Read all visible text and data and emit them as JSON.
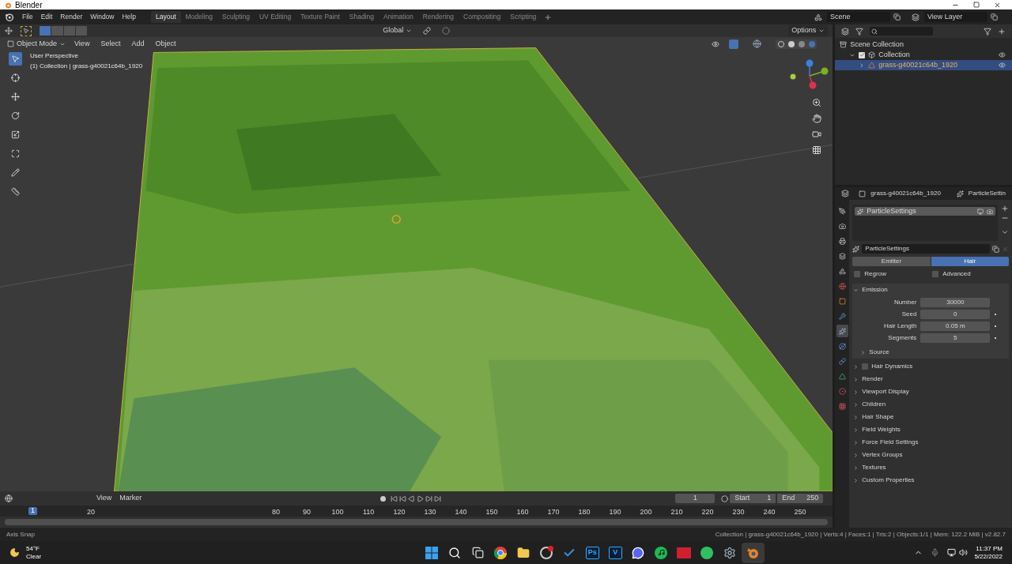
{
  "window": {
    "title": "Blender"
  },
  "menu": [
    "File",
    "Edit",
    "Render",
    "Window",
    "Help"
  ],
  "workspaces": [
    {
      "label": "Layout",
      "selected": true
    },
    {
      "label": "Modeling",
      "selected": false
    },
    {
      "label": "Sculpting",
      "selected": false
    },
    {
      "label": "UV Editing",
      "selected": false
    },
    {
      "label": "Texture Paint",
      "selected": false
    },
    {
      "label": "Shading",
      "selected": false
    },
    {
      "label": "Animation",
      "selected": false
    },
    {
      "label": "Rendering",
      "selected": false
    },
    {
      "label": "Compositing",
      "selected": false
    },
    {
      "label": "Scripting",
      "selected": false
    }
  ],
  "scene": "Scene",
  "view_layer": "View Layer",
  "viewport": {
    "orientation": "Global",
    "options": "Options",
    "mode": "Object Mode",
    "menus": [
      "View",
      "Select",
      "Add",
      "Object"
    ],
    "overlay_lines": [
      "User Perspective",
      "(1) Collection | grass-g40021c64b_1920"
    ],
    "tools": [
      {
        "kind": "select",
        "selected": true
      },
      {
        "kind": "cursor",
        "selected": false
      },
      {
        "kind": "move",
        "selected": false
      },
      {
        "kind": "rotate",
        "selected": false
      },
      {
        "kind": "scale",
        "selected": false
      },
      {
        "kind": "transform",
        "selected": false
      },
      {
        "kind": "annotate",
        "selected": false
      },
      {
        "kind": "measure",
        "selected": false
      }
    ]
  },
  "timeline": {
    "menus": [
      "View",
      "Marker"
    ],
    "current_frame": "1",
    "start_label": "Start",
    "start": "1",
    "end_label": "End",
    "end": "250",
    "playhead": "1",
    "ticks": [
      "20",
      "80",
      "90",
      "100",
      "110",
      "120",
      "130",
      "140",
      "150",
      "160",
      "170",
      "180",
      "190",
      "200",
      "210",
      "220",
      "230",
      "240",
      "250"
    ]
  },
  "outliner": {
    "items": [
      {
        "label": "Scene Collection",
        "kind": "scene",
        "selected": false,
        "children": [
          {
            "label": "Collection",
            "kind": "collection",
            "selected": false,
            "expanded": true,
            "checked": true,
            "children": [
              {
                "label": "grass-g40021c64b_1920",
                "kind": "object",
                "selected": true,
                "expanded": false
              }
            ]
          }
        ]
      }
    ]
  },
  "properties": {
    "object_name": "grass-g40021c64b_1920",
    "context": "ParticleSettin",
    "tabs": [
      {
        "kind": "tool",
        "selected": false
      },
      {
        "kind": "render",
        "selected": false
      },
      {
        "kind": "output",
        "selected": false
      },
      {
        "kind": "view_layer",
        "selected": false
      },
      {
        "kind": "scene",
        "selected": false
      },
      {
        "kind": "world",
        "selected": false
      },
      {
        "kind": "object",
        "selected": false
      },
      {
        "kind": "modifiers",
        "selected": false
      },
      {
        "kind": "particles",
        "selected": true
      },
      {
        "kind": "physics",
        "selected": false
      },
      {
        "kind": "constraints",
        "selected": false
      },
      {
        "kind": "data",
        "selected": false
      },
      {
        "kind": "material",
        "selected": false
      },
      {
        "kind": "texture",
        "selected": false
      }
    ],
    "particle_systems": [
      {
        "name": "ParticleSettings",
        "selected": true
      }
    ],
    "settings_name": "ParticleSettings",
    "type_options": [
      {
        "label": "Emitter",
        "selected": false
      },
      {
        "label": "Hair",
        "selected": true
      }
    ],
    "toggles": [
      {
        "label": "Regrow",
        "checked": false
      },
      {
        "label": "Advanced",
        "checked": false
      }
    ],
    "panels": [
      {
        "label": "Emission",
        "kind": "plain",
        "expanded": true,
        "fields": [
          {
            "label": "Number",
            "value": "30000",
            "keyframe_dot": false
          },
          {
            "label": "Seed",
            "value": "0",
            "keyframe_dot": true
          },
          {
            "label": "Hair Length",
            "value": "0.05 m",
            "keyframe_dot": true
          },
          {
            "label": "Segments",
            "value": "5",
            "keyframe_dot": true
          }
        ],
        "subpanels": [
          {
            "label": "Source",
            "expanded": false
          }
        ]
      },
      {
        "label": "Hair Dynamics",
        "kind": "toggle",
        "checked": false,
        "expanded": false
      },
      {
        "label": "Render",
        "kind": "plain",
        "expanded": false
      },
      {
        "label": "Viewport Display",
        "kind": "plain",
        "expanded": false
      },
      {
        "label": "Children",
        "kind": "plain",
        "expanded": false
      },
      {
        "label": "Hair Shape",
        "kind": "plain",
        "expanded": false
      },
      {
        "label": "Field Weights",
        "kind": "plain",
        "expanded": false
      },
      {
        "label": "Force Field Settings",
        "kind": "plain",
        "expanded": false
      },
      {
        "label": "Vertex Groups",
        "kind": "plain",
        "expanded": false
      },
      {
        "label": "Textures",
        "kind": "plain",
        "expanded": false
      },
      {
        "label": "Custom Properties",
        "kind": "plain",
        "expanded": false
      }
    ]
  },
  "status_bar": {
    "left": "Axis Snap",
    "right": "Collection | grass-g40021c64b_1920 | Verts:4 | Faces:1 | Tris:2 | Objects:1/1 | Mem: 122.2 MiB | v2.82.7"
  },
  "taskbar": {
    "weather": {
      "temp": "54°F",
      "condition": "Clear"
    },
    "apps": [
      {
        "kind": "start",
        "selected": false
      },
      {
        "kind": "search",
        "selected": false
      },
      {
        "kind": "taskview",
        "selected": false
      },
      {
        "kind": "browser",
        "selected": false
      },
      {
        "kind": "folder",
        "selected": false
      },
      {
        "kind": "recorder",
        "selected": false
      },
      {
        "kind": "check",
        "selected": false
      },
      {
        "kind": "lettered",
        "label": "Ps",
        "selected": false
      },
      {
        "kind": "lettered",
        "label": "V",
        "selected": false
      },
      {
        "kind": "chat",
        "selected": false
      },
      {
        "kind": "music",
        "selected": false
      },
      {
        "kind": "voice",
        "selected": false
      },
      {
        "kind": "phone",
        "selected": false
      },
      {
        "kind": "settings",
        "selected": false
      },
      {
        "kind": "blender",
        "selected": true
      }
    ],
    "time": "11:37 PM",
    "date": "5/22/2022"
  }
}
